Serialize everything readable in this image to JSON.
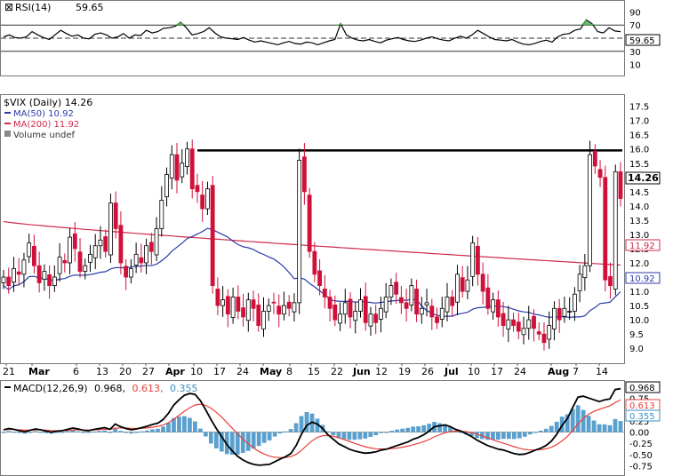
{
  "chart_data": [
    {
      "panel": "rsi",
      "type": "line",
      "indicator_label": "RSI(14)",
      "current_value_label": "59.65",
      "current_value": 59.65,
      "y_ticks": [
        "90",
        "70",
        "50",
        "30",
        "10"
      ],
      "y_tick_values": [
        90,
        70,
        50,
        30,
        10
      ],
      "ylim": [
        0,
        100
      ],
      "reference_lines": [
        70,
        50,
        30
      ],
      "line_color": "#000000",
      "overbought_fill": "#4caf50",
      "values": [
        52,
        55,
        51,
        50,
        52,
        60,
        55,
        51,
        48,
        55,
        62,
        57,
        53,
        55,
        50,
        49,
        56,
        58,
        55,
        50,
        52,
        57,
        50,
        55,
        54,
        62,
        58,
        60,
        65,
        66,
        68,
        74,
        66,
        55,
        57,
        60,
        66,
        58,
        52,
        50,
        49,
        48,
        51,
        47,
        44,
        46,
        44,
        42,
        40,
        43,
        45,
        42,
        41,
        44,
        43,
        40,
        43,
        46,
        48,
        72,
        55,
        50,
        47,
        46,
        48,
        45,
        43,
        47,
        49,
        51,
        48,
        46,
        45,
        47,
        50,
        52,
        49,
        47,
        46,
        50,
        53,
        50,
        55,
        62,
        57,
        52,
        48,
        47,
        46,
        48,
        44,
        41,
        40,
        42,
        45,
        47,
        44,
        52,
        56,
        57,
        62,
        64,
        78,
        72,
        60,
        58,
        66,
        61,
        60
      ]
    },
    {
      "panel": "price",
      "type": "candlestick",
      "symbol_label": "$VIX (Daily) 14.26",
      "last_label": "14.26",
      "last": 14.26,
      "ma50_label": "MA(50) 10.92",
      "ma50_value_label": "10.92",
      "ma50_last": 10.92,
      "ma50_color": "#2b3ba8",
      "ma200_label": "MA(200) 11.92",
      "ma200_value_label": "11.92",
      "ma200_last": 11.92,
      "ma200_color": "#d1284b",
      "volume_label": "Volume undef",
      "y_ticks": [
        "17.5",
        "17.0",
        "16.5",
        "16.0",
        "15.5",
        "15.0",
        "14.5",
        "14.0",
        "13.5",
        "13.0",
        "12.5",
        "12.0",
        "11.5",
        "11.0",
        "10.5",
        "10.0",
        "9.5",
        "9.0"
      ],
      "y_tick_values": [
        17.5,
        17.0,
        16.5,
        16.0,
        15.5,
        15.0,
        14.5,
        14.0,
        13.5,
        13.0,
        12.5,
        12.0,
        11.5,
        11.0,
        10.5,
        10.0,
        9.5,
        9.0
      ],
      "ylim": [
        8.6,
        17.8
      ],
      "resistance_level": 15.95,
      "up_color": "#ffffff",
      "down_color": "#d0103a",
      "close": [
        11.5,
        11.2,
        11.8,
        11.6,
        12.1,
        12.7,
        11.9,
        11.3,
        11.7,
        11.2,
        11.5,
        12.2,
        12.0,
        12.9,
        12.5,
        11.7,
        11.9,
        12.3,
        12.6,
        12.8,
        12.4,
        14.1,
        13.2,
        12.0,
        11.5,
        11.8,
        12.3,
        12.0,
        12.6,
        12.4,
        13.2,
        14.2,
        15.1,
        15.8,
        14.9,
        15.5,
        16.0,
        14.6,
        14.5,
        13.9,
        14.6,
        11.2,
        10.5,
        10.7,
        10.2,
        10.8,
        10.3,
        10.1,
        10.7,
        10.4,
        9.8,
        10.3,
        10.5,
        10.6,
        10.2,
        10.5,
        10.4,
        10.6,
        15.6,
        14.5,
        12.4,
        11.6,
        11.2,
        10.8,
        10.4,
        10.0,
        10.2,
        10.6,
        10.1,
        10.3,
        10.7,
        9.9,
        10.2,
        9.9,
        10.4,
        10.8,
        11.2,
        10.9,
        10.6,
        10.4,
        11.2,
        10.2,
        10.4,
        10.6,
        10.1,
        9.9,
        10.4,
        10.8,
        10.5,
        11.6,
        11.0,
        11.4,
        12.7,
        11.6,
        11.0,
        10.4,
        10.7,
        10.1,
        9.8,
        10.0,
        9.8,
        9.6,
        9.7,
        10.0,
        9.7,
        9.5,
        9.2,
        9.8,
        10.4,
        10.0,
        10.4,
        10.3,
        10.9,
        11.6,
        11.9,
        15.8,
        15.4,
        15.0,
        11.4,
        11.2,
        15.2,
        14.26
      ]
    },
    {
      "panel": "macd",
      "type": "line_histogram",
      "indicator_label": "MACD(12,26,9)",
      "macd_label": "0.968,",
      "signal_label": "0.613,",
      "hist_label": "0.355",
      "macd_last": 0.968,
      "signal_last": 0.613,
      "hist_last": 0.355,
      "y_ticks": [
        "0.75",
        "0.50",
        "0.25",
        "0.00",
        "-0.25",
        "-0.50",
        "-0.75"
      ],
      "y_tick_values": [
        0.75,
        0.5,
        0.25,
        0.0,
        -0.25,
        -0.5,
        -0.75
      ],
      "ylim": [
        -0.86,
        1.08
      ],
      "macd_color": "#000000",
      "signal_color": "#e8403a",
      "hist_color": "#3d8fc5",
      "macd": [
        0.05,
        0.08,
        0.06,
        0.03,
        0.01,
        0.04,
        0.07,
        0.05,
        0.02,
        0.0,
        0.02,
        0.03,
        0.06,
        0.09,
        0.07,
        0.04,
        0.03,
        0.06,
        0.08,
        0.1,
        0.06,
        0.18,
        0.12,
        0.08,
        0.05,
        0.07,
        0.1,
        0.13,
        0.17,
        0.2,
        0.28,
        0.42,
        0.6,
        0.72,
        0.82,
        0.86,
        0.84,
        0.7,
        0.5,
        0.28,
        0.08,
        -0.1,
        -0.28,
        -0.42,
        -0.54,
        -0.62,
        -0.68,
        -0.72,
        -0.74,
        -0.73,
        -0.72,
        -0.66,
        -0.6,
        -0.55,
        -0.48,
        -0.3,
        -0.05,
        0.15,
        0.22,
        0.18,
        0.08,
        -0.06,
        -0.16,
        -0.26,
        -0.32,
        -0.38,
        -0.42,
        -0.45,
        -0.47,
        -0.46,
        -0.44,
        -0.4,
        -0.38,
        -0.34,
        -0.3,
        -0.26,
        -0.22,
        -0.16,
        -0.12,
        -0.06,
        0.02,
        0.12,
        0.14,
        0.16,
        0.12,
        0.06,
        0.02,
        -0.04,
        -0.1,
        -0.18,
        -0.24,
        -0.3,
        -0.34,
        -0.38,
        -0.4,
        -0.44,
        -0.48,
        -0.5,
        -0.49,
        -0.45,
        -0.4,
        -0.36,
        -0.3,
        -0.2,
        -0.05,
        0.15,
        0.3,
        0.55,
        0.78,
        0.8,
        0.76,
        0.72,
        0.68,
        0.72,
        0.74,
        0.95,
        0.968
      ]
    }
  ],
  "x_axis": {
    "tick_labels": [
      "21",
      "Mar",
      "6",
      "13",
      "20",
      "27",
      "Apr",
      "10",
      "17",
      "24",
      "May",
      "8",
      "15",
      "22",
      "Jun",
      "12",
      "19",
      "26",
      "Jul",
      "10",
      "17",
      "24",
      "Aug",
      "7",
      "14"
    ],
    "month_labels": [
      "Mar",
      "Apr",
      "May",
      "Jun",
      "Jul",
      "Aug"
    ]
  }
}
